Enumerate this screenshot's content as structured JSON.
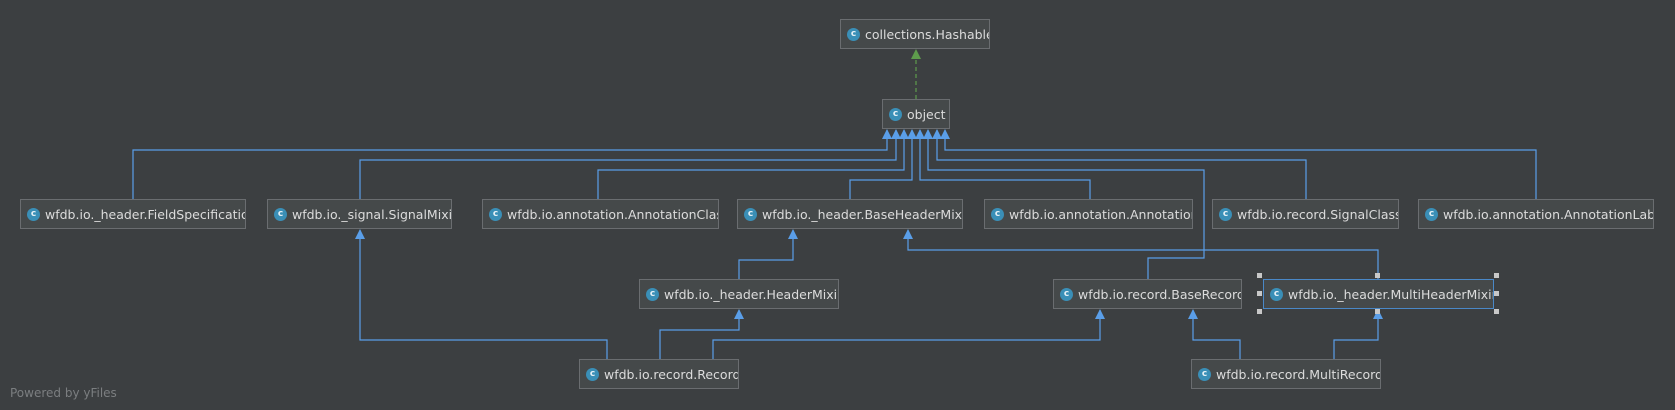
{
  "icon_letter": "c",
  "colors": {
    "background": "#3c3f41",
    "node_fill": "#45494a",
    "node_border": "#6a6d70",
    "class_icon": "#3a8fb7",
    "inheritance_edge": "#5a9ee8",
    "realization_edge": "#5e9c4c",
    "selection": "#4a88c7"
  },
  "nodes": {
    "hashable": "collections.Hashable",
    "object": "object",
    "field_specification": "wfdb.io._header.FieldSpecification",
    "signal_mixin": "wfdb.io._signal.SignalMixin",
    "annotation_class": "wfdb.io.annotation.AnnotationClass",
    "base_header_mixin": "wfdb.io._header.BaseHeaderMixin",
    "annotation": "wfdb.io.annotation.Annotation",
    "signal_class": "wfdb.io.record.SignalClass",
    "annotation_label": "wfdb.io.annotation.AnnotationLabel",
    "header_mixin": "wfdb.io._header.HeaderMixin",
    "base_record": "wfdb.io.record.BaseRecord",
    "multi_header_mixin": "wfdb.io._header.MultiHeaderMixin",
    "record": "wfdb.io.record.Record",
    "multi_record": "wfdb.io.record.MultiRecord"
  },
  "watermark": "Powered by yFiles"
}
